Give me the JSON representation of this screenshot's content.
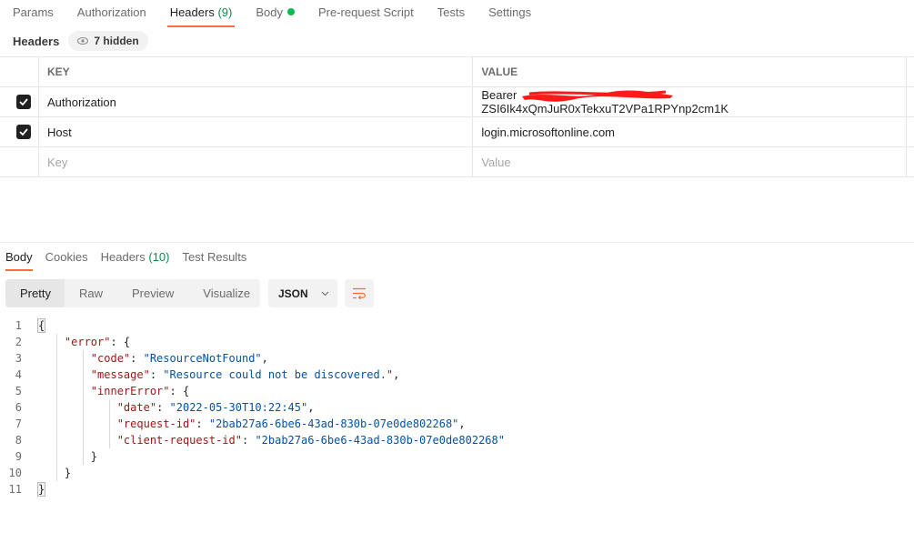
{
  "request_tabs": [
    {
      "label": "Params"
    },
    {
      "label": "Authorization"
    },
    {
      "label": "Headers",
      "count": "(9)",
      "active": true
    },
    {
      "label": "Body",
      "dot": true
    },
    {
      "label": "Pre-request Script"
    },
    {
      "label": "Tests"
    },
    {
      "label": "Settings"
    }
  ],
  "headers_section": {
    "title": "Headers",
    "hidden_label": "7 hidden",
    "columns": {
      "key": "KEY",
      "value": "VALUE"
    },
    "rows": [
      {
        "checked": true,
        "key": "Authorization",
        "value_prefix": "Bearer ",
        "value_suffix": "ZSI6Ik4xQmJuR0xTekxuT2VPa1RPYnp2cm1K",
        "redacted": true
      },
      {
        "checked": true,
        "key": "Host",
        "value": "login.microsoftonline.com"
      }
    ],
    "new_row": {
      "key_placeholder": "Key",
      "value_placeholder": "Value"
    }
  },
  "response_tabs": [
    {
      "label": "Body",
      "active": true
    },
    {
      "label": "Cookies"
    },
    {
      "label": "Headers",
      "count": "(10)"
    },
    {
      "label": "Test Results"
    }
  ],
  "view_modes": [
    "Pretty",
    "Raw",
    "Preview",
    "Visualize"
  ],
  "active_view": "Pretty",
  "format_select": {
    "value": "JSON"
  },
  "colors": {
    "accent": "#ff6c37",
    "count_green": "#0f8a4e",
    "dot_green": "#0cbb52",
    "json_key": "#a31515",
    "json_string": "#0451a5"
  },
  "response_body": {
    "lines": [
      {
        "n": "1",
        "indent": 0,
        "tokens": [
          {
            "t": "p",
            "v": "{"
          }
        ]
      },
      {
        "n": "2",
        "indent": 1,
        "tokens": [
          {
            "t": "k",
            "v": "\"error\""
          },
          {
            "t": "p",
            "v": ": {"
          }
        ]
      },
      {
        "n": "3",
        "indent": 2,
        "tokens": [
          {
            "t": "k",
            "v": "\"code\""
          },
          {
            "t": "p",
            "v": ": "
          },
          {
            "t": "s",
            "v": "\"ResourceNotFound\""
          },
          {
            "t": "p",
            "v": ","
          }
        ]
      },
      {
        "n": "4",
        "indent": 2,
        "tokens": [
          {
            "t": "k",
            "v": "\"message\""
          },
          {
            "t": "p",
            "v": ": "
          },
          {
            "t": "s",
            "v": "\"Resource could not be discovered.\""
          },
          {
            "t": "p",
            "v": ","
          }
        ]
      },
      {
        "n": "5",
        "indent": 2,
        "tokens": [
          {
            "t": "k",
            "v": "\"innerError\""
          },
          {
            "t": "p",
            "v": ": {"
          }
        ]
      },
      {
        "n": "6",
        "indent": 3,
        "tokens": [
          {
            "t": "k",
            "v": "\"date\""
          },
          {
            "t": "p",
            "v": ": "
          },
          {
            "t": "s",
            "v": "\"2022-05-30T10:22:45\""
          },
          {
            "t": "p",
            "v": ","
          }
        ]
      },
      {
        "n": "7",
        "indent": 3,
        "tokens": [
          {
            "t": "k",
            "v": "\"request-id\""
          },
          {
            "t": "p",
            "v": ": "
          },
          {
            "t": "s",
            "v": "\"2bab27a6-6be6-43ad-830b-07e0de802268\""
          },
          {
            "t": "p",
            "v": ","
          }
        ]
      },
      {
        "n": "8",
        "indent": 3,
        "tokens": [
          {
            "t": "k",
            "v": "\"client-request-id\""
          },
          {
            "t": "p",
            "v": ": "
          },
          {
            "t": "s",
            "v": "\"2bab27a6-6be6-43ad-830b-07e0de802268\""
          }
        ]
      },
      {
        "n": "9",
        "indent": 2,
        "tokens": [
          {
            "t": "p",
            "v": "}"
          }
        ]
      },
      {
        "n": "10",
        "indent": 1,
        "tokens": [
          {
            "t": "p",
            "v": "}"
          }
        ]
      },
      {
        "n": "11",
        "indent": 0,
        "tokens": [
          {
            "t": "p",
            "v": "}"
          }
        ]
      }
    ]
  }
}
